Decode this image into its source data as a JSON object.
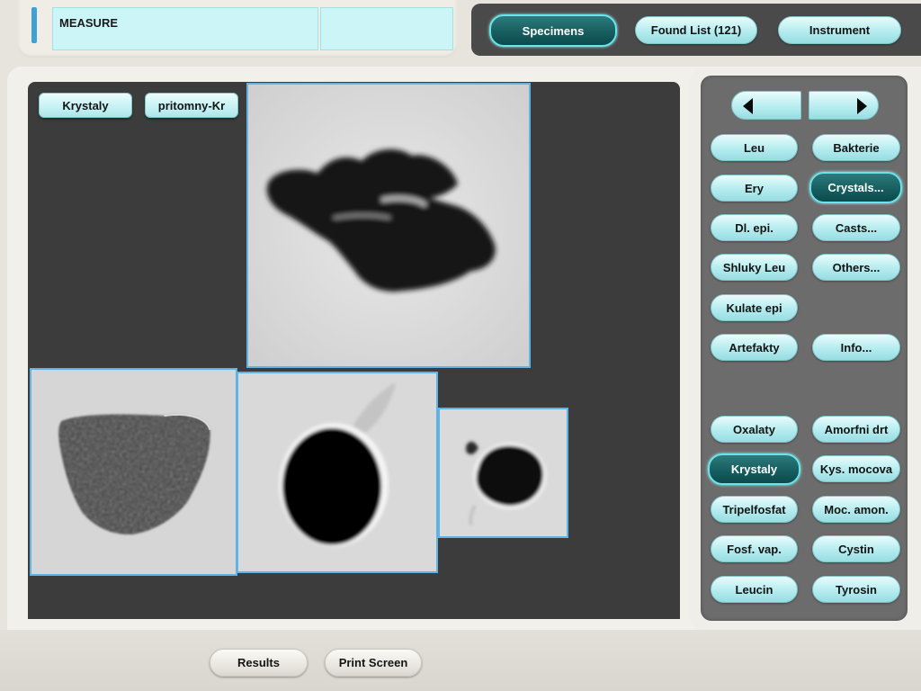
{
  "measure": {
    "title": "MEASURE",
    "second_value": ""
  },
  "tabs": [
    {
      "label": "Specimens",
      "active": true
    },
    {
      "label": "Found List (121)",
      "active": false
    },
    {
      "label": "Instrument",
      "active": false
    }
  ],
  "viewer": {
    "filters": [
      {
        "label": "Krystaly"
      },
      {
        "label": "pritomny-Kr"
      }
    ]
  },
  "nav": {
    "prev_icon": "arrow-left-icon",
    "next_icon": "arrow-right-icon"
  },
  "categories": [
    {
      "label": "Leu",
      "active": false
    },
    {
      "label": "Bakterie",
      "active": false
    },
    {
      "label": "Ery",
      "active": false
    },
    {
      "label": "Crystals...",
      "active": true
    },
    {
      "label": "Dl. epi.",
      "active": false
    },
    {
      "label": "Casts...",
      "active": false
    },
    {
      "label": "Shluky Leu",
      "active": false
    },
    {
      "label": "Others...",
      "active": false
    },
    {
      "label": "Kulate epi",
      "active": false
    },
    {
      "label": "Artefakty",
      "active": false
    },
    {
      "label": "Info...",
      "active": false
    }
  ],
  "subcategories": [
    {
      "label": "Oxalaty",
      "active": false
    },
    {
      "label": "Amorfni drt",
      "active": false
    },
    {
      "label": "Krystaly",
      "active": true
    },
    {
      "label": "Kys. mocova",
      "active": false
    },
    {
      "label": "Tripelfosfat",
      "active": false
    },
    {
      "label": "Moc. amon.",
      "active": false
    },
    {
      "label": "Fosf. vap.",
      "active": false
    },
    {
      "label": "Cystin",
      "active": false
    },
    {
      "label": "Leucin",
      "active": false
    },
    {
      "label": "Tyrosin",
      "active": false
    }
  ],
  "bottom": {
    "results_label": "Results",
    "print_label": "Print Screen"
  },
  "colors": {
    "accent": "#5fb3e6",
    "active_button": "#155c5e",
    "button": "#b4ecef",
    "viewer_bg": "#3b3c3b"
  }
}
